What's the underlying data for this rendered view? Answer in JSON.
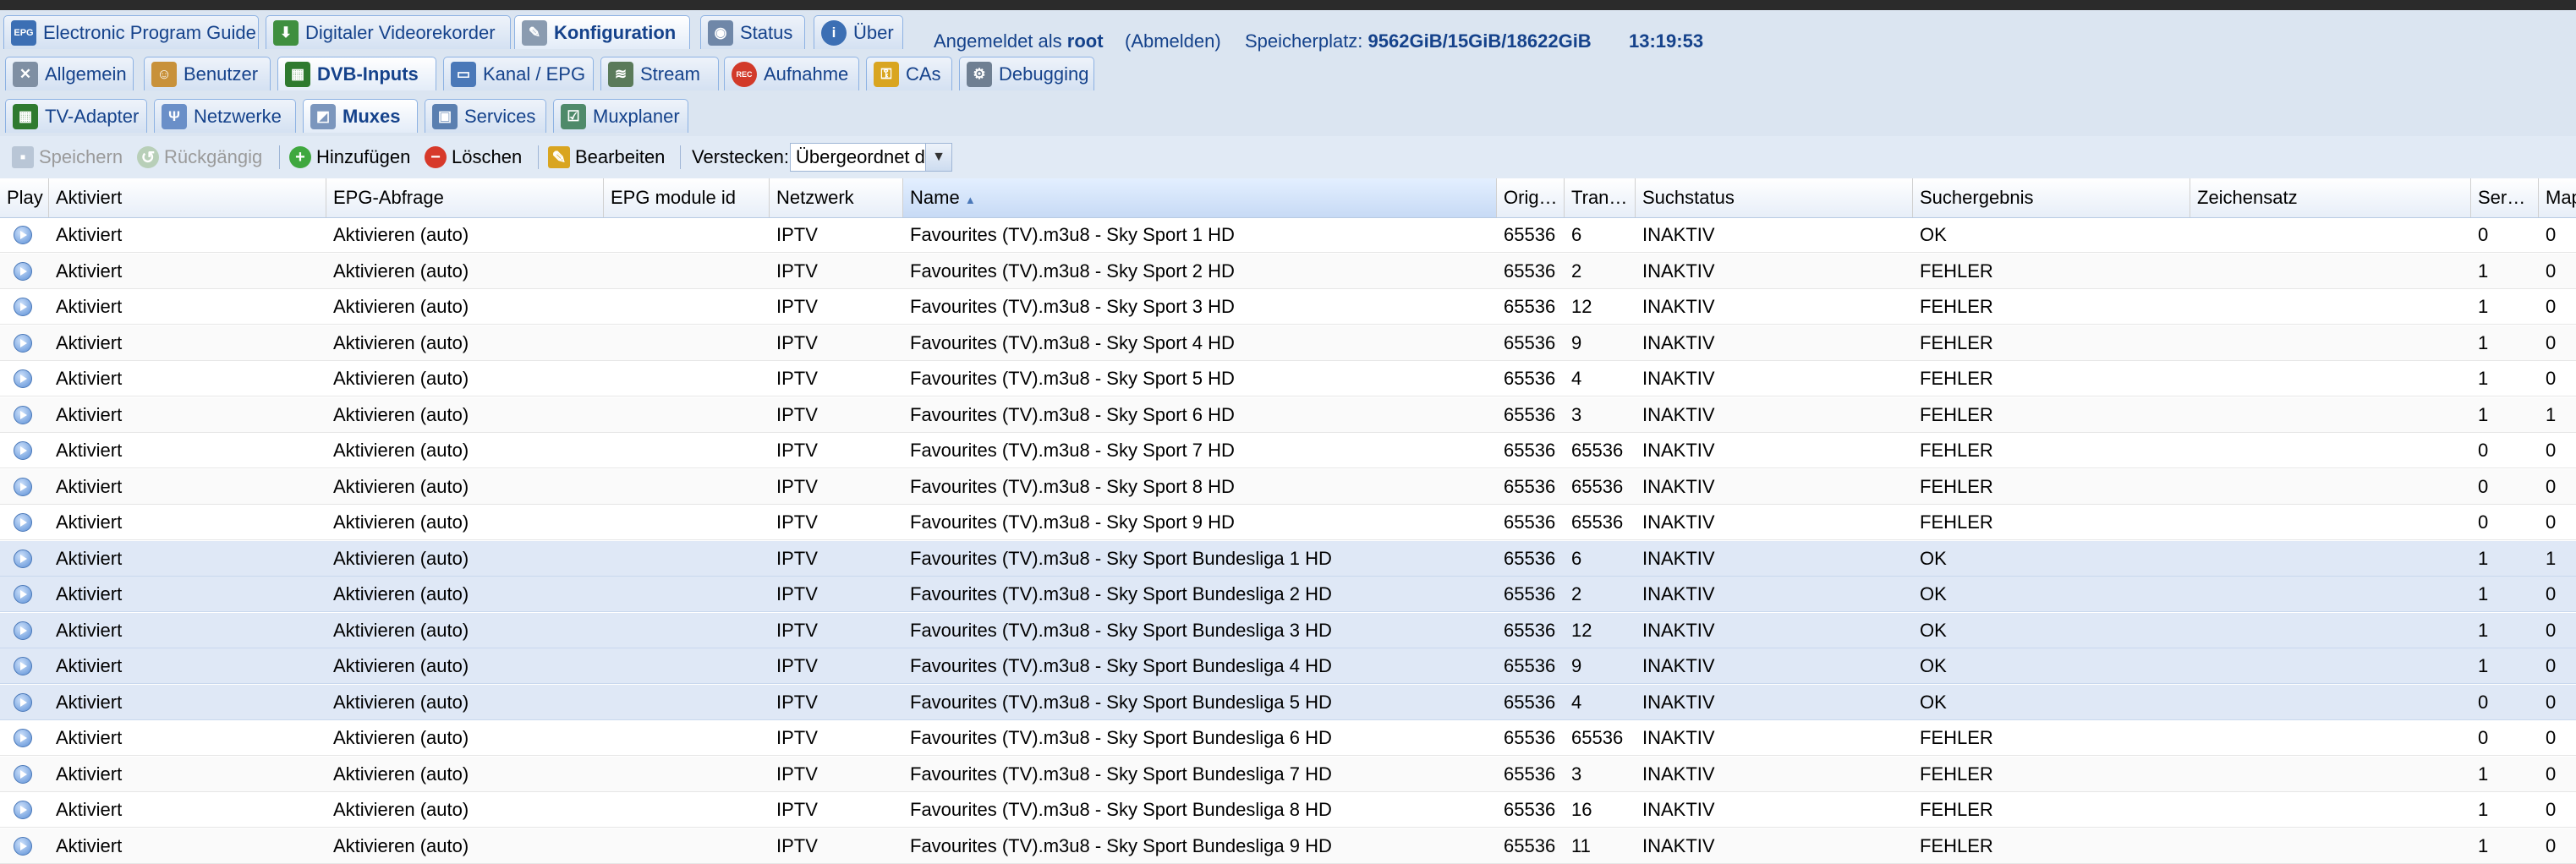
{
  "main_tabs": [
    {
      "label": "Electronic Program Guide",
      "icon": "epg-icon"
    },
    {
      "label": "Digitaler Videorekorder",
      "icon": "download-icon"
    },
    {
      "label": "Konfiguration",
      "icon": "wrench-icon",
      "active": true
    },
    {
      "label": "Status",
      "icon": "eye-icon"
    },
    {
      "label": "Über",
      "icon": "info-icon"
    }
  ],
  "session": {
    "logged_in_prefix": "Angemeldet als",
    "user": "root",
    "logout": "(Abmelden)",
    "storage_label": "Speicherplatz:",
    "storage_value": "9562GiB/15GiB/18622GiB",
    "clock": "13:19:53"
  },
  "config_tabs": [
    {
      "label": "Allgemein",
      "icon": "tools-icon"
    },
    {
      "label": "Benutzer",
      "icon": "users-icon"
    },
    {
      "label": "DVB-Inputs",
      "icon": "dvb-card-icon",
      "active": true
    },
    {
      "label": "Kanal / EPG",
      "icon": "tv-icon"
    },
    {
      "label": "Stream",
      "icon": "stream-icon"
    },
    {
      "label": "Aufnahme",
      "icon": "rec-icon"
    },
    {
      "label": "CAs",
      "icon": "key-icon"
    },
    {
      "label": "Debugging",
      "icon": "gears-icon"
    }
  ],
  "dvb_tabs": [
    {
      "label": "TV-Adapter",
      "icon": "adapter-icon"
    },
    {
      "label": "Netzwerke",
      "icon": "antenna-icon"
    },
    {
      "label": "Muxes",
      "icon": "mux-icon",
      "active": true
    },
    {
      "label": "Services",
      "icon": "services-icon"
    },
    {
      "label": "Muxplaner",
      "icon": "scheduler-icon"
    }
  ],
  "toolbar": {
    "save": "Speichern",
    "undo": "Rückgängig",
    "add": "Hinzufügen",
    "delete": "Löschen",
    "edit": "Bearbeiten",
    "hide_label": "Verstecken:",
    "hide_value": "Übergeordnet d"
  },
  "columns": [
    "Play",
    "Aktiviert",
    "EPG-Abfrage",
    "EPG module id",
    "Netzwerk",
    "Name",
    "Orig…",
    "Tran…",
    "Suchstatus",
    "Suchergebnis",
    "Zeichensatz",
    "Ser…",
    "Map"
  ],
  "rows": [
    {
      "aktiviert": "Aktiviert",
      "epg": "Aktivieren (auto)",
      "epg_module": "",
      "netzwerk": "IPTV",
      "name": "Favourites (TV).m3u8 - Sky Sport 1 HD",
      "orig": "65536",
      "tran": "6",
      "suchstatus": "INAKTIV",
      "suchergebnis": "OK",
      "zeichensatz": "",
      "ser": "0",
      "map": "0",
      "selected": false
    },
    {
      "aktiviert": "Aktiviert",
      "epg": "Aktivieren (auto)",
      "epg_module": "",
      "netzwerk": "IPTV",
      "name": "Favourites (TV).m3u8 - Sky Sport 2 HD",
      "orig": "65536",
      "tran": "2",
      "suchstatus": "INAKTIV",
      "suchergebnis": "FEHLER",
      "zeichensatz": "",
      "ser": "1",
      "map": "0",
      "selected": false
    },
    {
      "aktiviert": "Aktiviert",
      "epg": "Aktivieren (auto)",
      "epg_module": "",
      "netzwerk": "IPTV",
      "name": "Favourites (TV).m3u8 - Sky Sport 3 HD",
      "orig": "65536",
      "tran": "12",
      "suchstatus": "INAKTIV",
      "suchergebnis": "FEHLER",
      "zeichensatz": "",
      "ser": "1",
      "map": "0",
      "selected": false
    },
    {
      "aktiviert": "Aktiviert",
      "epg": "Aktivieren (auto)",
      "epg_module": "",
      "netzwerk": "IPTV",
      "name": "Favourites (TV).m3u8 - Sky Sport 4 HD",
      "orig": "65536",
      "tran": "9",
      "suchstatus": "INAKTIV",
      "suchergebnis": "FEHLER",
      "zeichensatz": "",
      "ser": "1",
      "map": "0",
      "selected": false
    },
    {
      "aktiviert": "Aktiviert",
      "epg": "Aktivieren (auto)",
      "epg_module": "",
      "netzwerk": "IPTV",
      "name": "Favourites (TV).m3u8 - Sky Sport 5 HD",
      "orig": "65536",
      "tran": "4",
      "suchstatus": "INAKTIV",
      "suchergebnis": "FEHLER",
      "zeichensatz": "",
      "ser": "1",
      "map": "0",
      "selected": false
    },
    {
      "aktiviert": "Aktiviert",
      "epg": "Aktivieren (auto)",
      "epg_module": "",
      "netzwerk": "IPTV",
      "name": "Favourites (TV).m3u8 - Sky Sport 6 HD",
      "orig": "65536",
      "tran": "3",
      "suchstatus": "INAKTIV",
      "suchergebnis": "FEHLER",
      "zeichensatz": "",
      "ser": "1",
      "map": "1",
      "selected": false
    },
    {
      "aktiviert": "Aktiviert",
      "epg": "Aktivieren (auto)",
      "epg_module": "",
      "netzwerk": "IPTV",
      "name": "Favourites (TV).m3u8 - Sky Sport 7 HD",
      "orig": "65536",
      "tran": "65536",
      "suchstatus": "INAKTIV",
      "suchergebnis": "FEHLER",
      "zeichensatz": "",
      "ser": "0",
      "map": "0",
      "selected": false
    },
    {
      "aktiviert": "Aktiviert",
      "epg": "Aktivieren (auto)",
      "epg_module": "",
      "netzwerk": "IPTV",
      "name": "Favourites (TV).m3u8 - Sky Sport 8 HD",
      "orig": "65536",
      "tran": "65536",
      "suchstatus": "INAKTIV",
      "suchergebnis": "FEHLER",
      "zeichensatz": "",
      "ser": "0",
      "map": "0",
      "selected": false
    },
    {
      "aktiviert": "Aktiviert",
      "epg": "Aktivieren (auto)",
      "epg_module": "",
      "netzwerk": "IPTV",
      "name": "Favourites (TV).m3u8 - Sky Sport 9 HD",
      "orig": "65536",
      "tran": "65536",
      "suchstatus": "INAKTIV",
      "suchergebnis": "FEHLER",
      "zeichensatz": "",
      "ser": "0",
      "map": "0",
      "selected": false
    },
    {
      "aktiviert": "Aktiviert",
      "epg": "Aktivieren (auto)",
      "epg_module": "",
      "netzwerk": "IPTV",
      "name": "Favourites (TV).m3u8 - Sky Sport Bundesliga 1 HD",
      "orig": "65536",
      "tran": "6",
      "suchstatus": "INAKTIV",
      "suchergebnis": "OK",
      "zeichensatz": "",
      "ser": "1",
      "map": "1",
      "selected": true
    },
    {
      "aktiviert": "Aktiviert",
      "epg": "Aktivieren (auto)",
      "epg_module": "",
      "netzwerk": "IPTV",
      "name": "Favourites (TV).m3u8 - Sky Sport Bundesliga 2 HD",
      "orig": "65536",
      "tran": "2",
      "suchstatus": "INAKTIV",
      "suchergebnis": "OK",
      "zeichensatz": "",
      "ser": "1",
      "map": "0",
      "selected": true
    },
    {
      "aktiviert": "Aktiviert",
      "epg": "Aktivieren (auto)",
      "epg_module": "",
      "netzwerk": "IPTV",
      "name": "Favourites (TV).m3u8 - Sky Sport Bundesliga 3 HD",
      "orig": "65536",
      "tran": "12",
      "suchstatus": "INAKTIV",
      "suchergebnis": "OK",
      "zeichensatz": "",
      "ser": "1",
      "map": "0",
      "selected": true
    },
    {
      "aktiviert": "Aktiviert",
      "epg": "Aktivieren (auto)",
      "epg_module": "",
      "netzwerk": "IPTV",
      "name": "Favourites (TV).m3u8 - Sky Sport Bundesliga 4 HD",
      "orig": "65536",
      "tran": "9",
      "suchstatus": "INAKTIV",
      "suchergebnis": "OK",
      "zeichensatz": "",
      "ser": "1",
      "map": "0",
      "selected": true
    },
    {
      "aktiviert": "Aktiviert",
      "epg": "Aktivieren (auto)",
      "epg_module": "",
      "netzwerk": "IPTV",
      "name": "Favourites (TV).m3u8 - Sky Sport Bundesliga 5 HD",
      "orig": "65536",
      "tran": "4",
      "suchstatus": "INAKTIV",
      "suchergebnis": "OK",
      "zeichensatz": "",
      "ser": "0",
      "map": "0",
      "selected": true
    },
    {
      "aktiviert": "Aktiviert",
      "epg": "Aktivieren (auto)",
      "epg_module": "",
      "netzwerk": "IPTV",
      "name": "Favourites (TV).m3u8 - Sky Sport Bundesliga 6 HD",
      "orig": "65536",
      "tran": "65536",
      "suchstatus": "INAKTIV",
      "suchergebnis": "FEHLER",
      "zeichensatz": "",
      "ser": "0",
      "map": "0",
      "selected": false
    },
    {
      "aktiviert": "Aktiviert",
      "epg": "Aktivieren (auto)",
      "epg_module": "",
      "netzwerk": "IPTV",
      "name": "Favourites (TV).m3u8 - Sky Sport Bundesliga 7 HD",
      "orig": "65536",
      "tran": "3",
      "suchstatus": "INAKTIV",
      "suchergebnis": "FEHLER",
      "zeichensatz": "",
      "ser": "1",
      "map": "0",
      "selected": false
    },
    {
      "aktiviert": "Aktiviert",
      "epg": "Aktivieren (auto)",
      "epg_module": "",
      "netzwerk": "IPTV",
      "name": "Favourites (TV).m3u8 - Sky Sport Bundesliga 8 HD",
      "orig": "65536",
      "tran": "16",
      "suchstatus": "INAKTIV",
      "suchergebnis": "FEHLER",
      "zeichensatz": "",
      "ser": "1",
      "map": "0",
      "selected": false
    },
    {
      "aktiviert": "Aktiviert",
      "epg": "Aktivieren (auto)",
      "epg_module": "",
      "netzwerk": "IPTV",
      "name": "Favourites (TV).m3u8 - Sky Sport Bundesliga 9 HD",
      "orig": "65536",
      "tran": "11",
      "suchstatus": "INAKTIV",
      "suchergebnis": "FEHLER",
      "zeichensatz": "",
      "ser": "1",
      "map": "0",
      "selected": false
    }
  ],
  "colors": {
    "tab_text": "#15428b",
    "bar_bg": "#dbe5f1",
    "selected_row": "#dfe8f6",
    "accent": "#5b8fd6"
  }
}
